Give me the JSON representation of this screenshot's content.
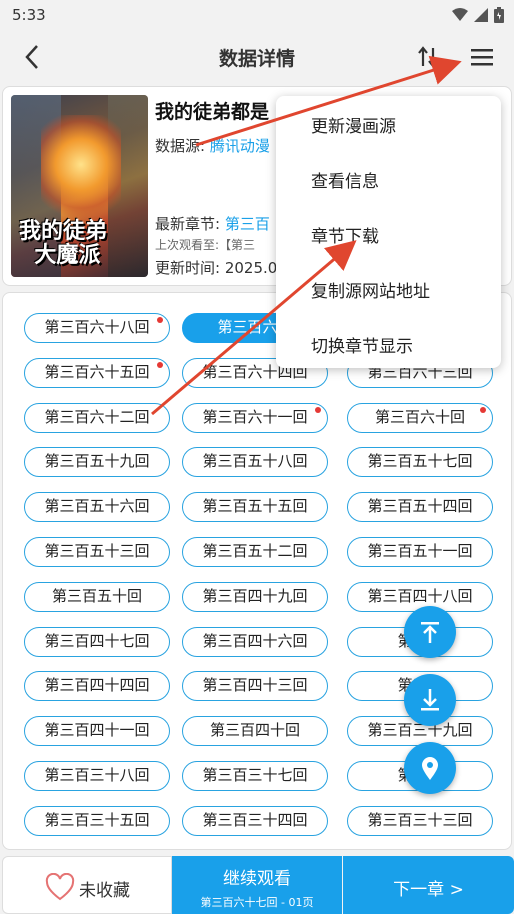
{
  "status_bar": {
    "time": "5:33",
    "icons": [
      "wifi-icon",
      "signal-icon",
      "battery-icon"
    ]
  },
  "app_bar": {
    "title": "数据详情",
    "icons": [
      "back-arrow-icon",
      "sort-icon",
      "menu-icon"
    ]
  },
  "comic": {
    "title": "我的徒弟都是",
    "source_label": "数据源:",
    "source_value": "腾讯动漫",
    "latest_label": "最新章节:",
    "latest_value": "第三百",
    "last_read_label": "上次观看至:【第三",
    "updated_label": "更新时间:",
    "updated_value": "2025.0",
    "cover_text": "我的徒弟 大魔派"
  },
  "menu": {
    "items": [
      "更新漫画源",
      "查看信息",
      "章节下载",
      "复制源网站地址",
      "切换章节显示"
    ]
  },
  "chapters": [
    {
      "label": "第三百六十八回",
      "dot": true,
      "active": false
    },
    {
      "label": "第三百六十",
      "dot": false,
      "active": true
    },
    {
      "label": "",
      "dot": false,
      "active": false
    },
    {
      "label": "第三百六十五回",
      "dot": true,
      "active": false
    },
    {
      "label": "第三百六十四回",
      "dot": false,
      "active": false
    },
    {
      "label": "第三百六十三回",
      "dot": false,
      "active": false
    },
    {
      "label": "第三百六十二回",
      "dot": false,
      "active": false
    },
    {
      "label": "第三百六十一回",
      "dot": true,
      "active": false
    },
    {
      "label": "第三百六十回",
      "dot": true,
      "active": false
    },
    {
      "label": "第三百五十九回",
      "dot": false,
      "active": false
    },
    {
      "label": "第三百五十八回",
      "dot": false,
      "active": false
    },
    {
      "label": "第三百五十七回",
      "dot": false,
      "active": false
    },
    {
      "label": "第三百五十六回",
      "dot": false,
      "active": false
    },
    {
      "label": "第三百五十五回",
      "dot": false,
      "active": false
    },
    {
      "label": "第三百五十四回",
      "dot": false,
      "active": false
    },
    {
      "label": "第三百五十三回",
      "dot": false,
      "active": false
    },
    {
      "label": "第三百五十二回",
      "dot": false,
      "active": false
    },
    {
      "label": "第三百五十一回",
      "dot": false,
      "active": false
    },
    {
      "label": "第三百五十回",
      "dot": false,
      "active": false
    },
    {
      "label": "第三百四十九回",
      "dot": false,
      "active": false
    },
    {
      "label": "第三百四十八回",
      "dot": false,
      "active": false
    },
    {
      "label": "第三百四十七回",
      "dot": false,
      "active": false
    },
    {
      "label": "第三百四十六回",
      "dot": false,
      "active": false
    },
    {
      "label": "第三百",
      "dot": false,
      "active": false
    },
    {
      "label": "第三百四十四回",
      "dot": false,
      "active": false
    },
    {
      "label": "第三百四十三回",
      "dot": false,
      "active": false
    },
    {
      "label": "第三百",
      "dot": false,
      "active": false
    },
    {
      "label": "第三百四十一回",
      "dot": false,
      "active": false
    },
    {
      "label": "第三百四十回",
      "dot": false,
      "active": false
    },
    {
      "label": "第三百三十九回",
      "dot": false,
      "active": false
    },
    {
      "label": "第三百三十八回",
      "dot": false,
      "active": false
    },
    {
      "label": "第三百三十七回",
      "dot": false,
      "active": false
    },
    {
      "label": "第三百",
      "dot": false,
      "active": false
    },
    {
      "label": "第三百三十五回",
      "dot": false,
      "active": false
    },
    {
      "label": "第三百三十四回",
      "dot": false,
      "active": false
    },
    {
      "label": "第三百三十三回",
      "dot": false,
      "active": false
    }
  ],
  "fabs": [
    "scroll-top-icon",
    "scroll-bottom-icon",
    "locate-icon"
  ],
  "bottom_bar": {
    "favorite_label": "未收藏",
    "continue_label": "继续观看",
    "continue_sub": "第三百六十七回 - 01页",
    "next_label": "下一章 >"
  },
  "colors": {
    "accent": "#19a0ea",
    "annotation": "#e0462f",
    "badge": "#e53935"
  }
}
